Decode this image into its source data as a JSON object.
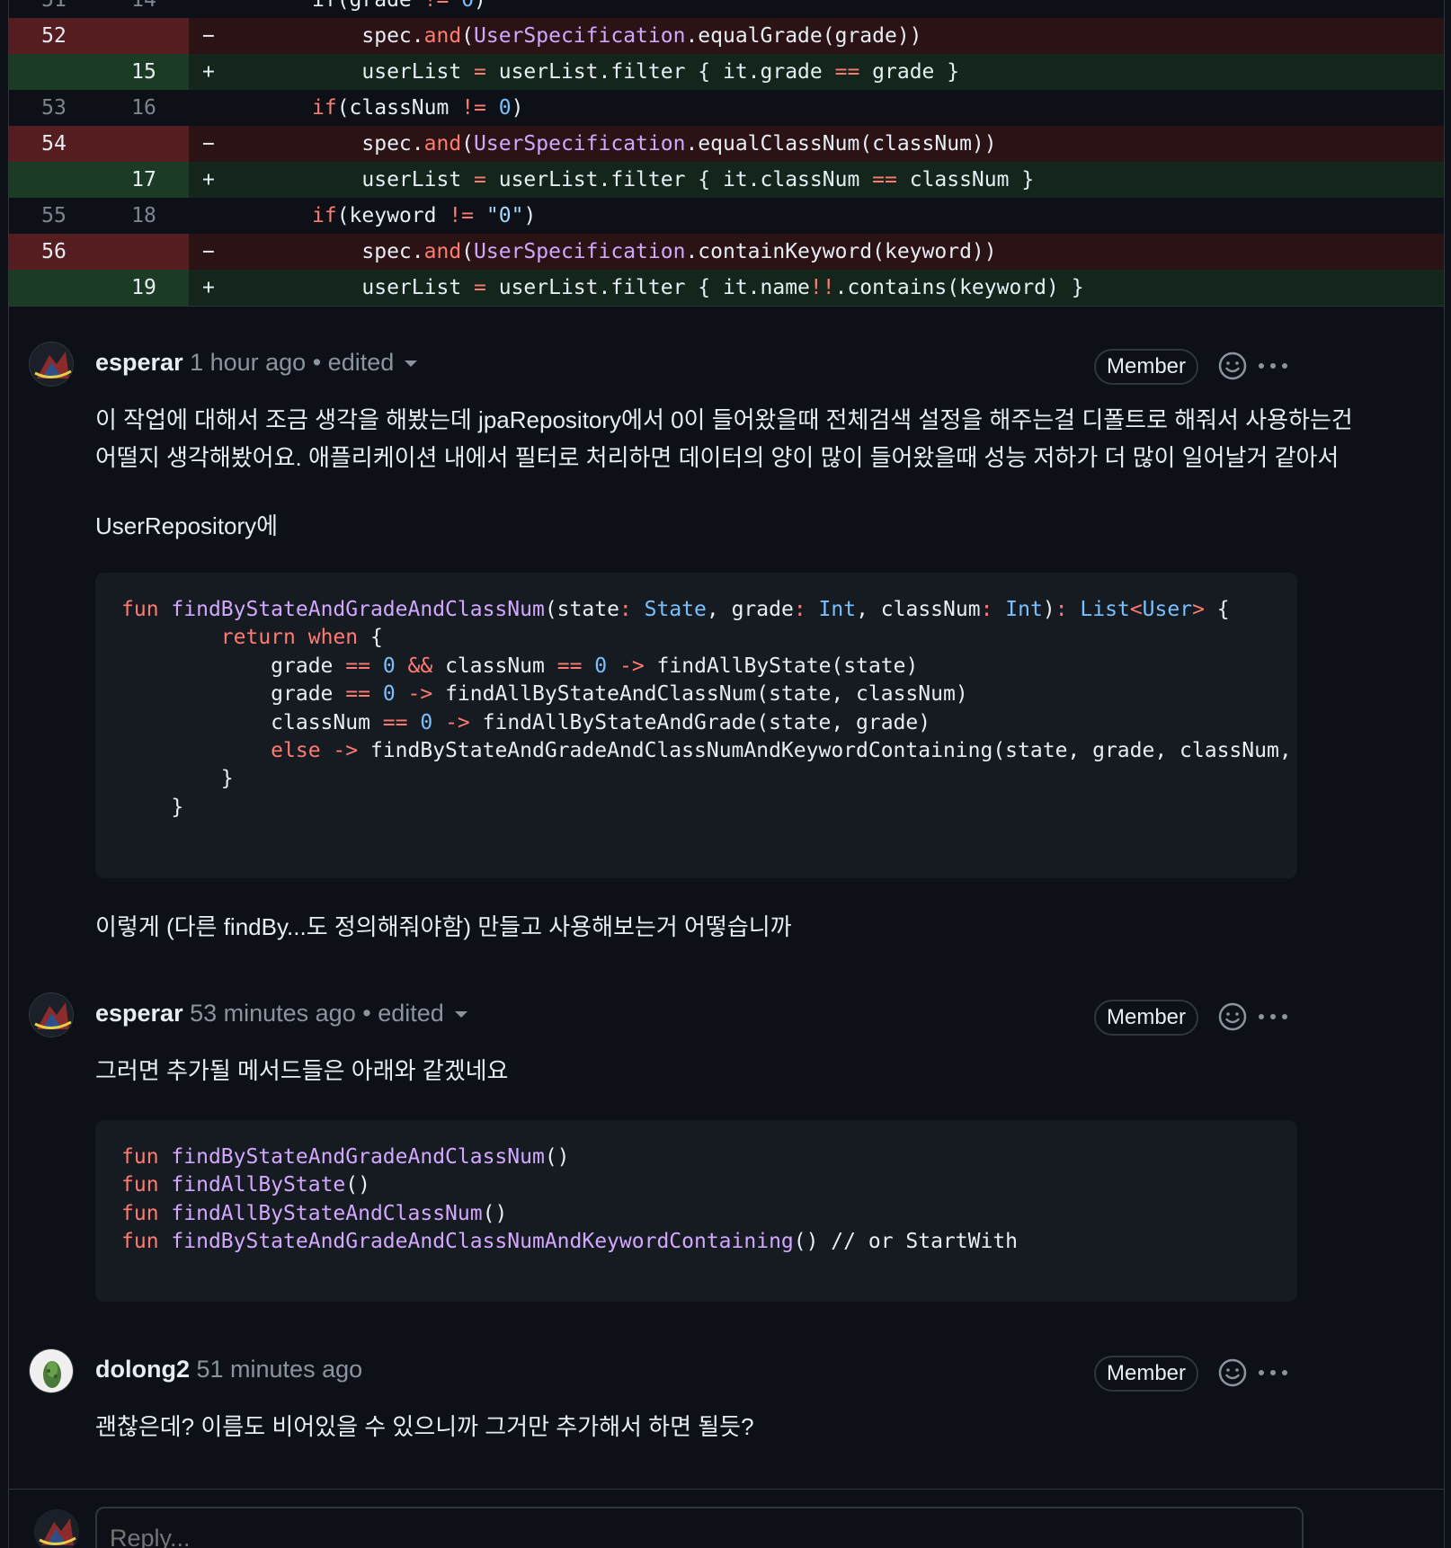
{
  "diff": {
    "rows": [
      {
        "type": "ctx",
        "old": "51",
        "new": "14",
        "sign": "",
        "partial": true
      },
      {
        "type": "del",
        "old": "52",
        "new": "",
        "sign": "−"
      },
      {
        "type": "add",
        "old": "",
        "new": "15",
        "sign": "+"
      },
      {
        "type": "ctx",
        "old": "53",
        "new": "16",
        "sign": ""
      },
      {
        "type": "del",
        "old": "54",
        "new": "",
        "sign": "−"
      },
      {
        "type": "add",
        "old": "",
        "new": "17",
        "sign": "+"
      },
      {
        "type": "ctx",
        "old": "55",
        "new": "18",
        "sign": ""
      },
      {
        "type": "del",
        "old": "56",
        "new": "",
        "sign": "−"
      },
      {
        "type": "add",
        "old": "",
        "new": "19",
        "sign": "+"
      }
    ],
    "code": [
      [
        [
          "if(grade ",
          ""
        ],
        [
          "!=",
          "op"
        ],
        [
          " ",
          ""
        ],
        [
          "0",
          "t"
        ],
        [
          ")",
          ""
        ]
      ],
      [
        [
          "    spec.",
          ""
        ],
        [
          "and",
          "k"
        ],
        [
          "(",
          ""
        ],
        [
          "UserSpecification",
          "f"
        ],
        [
          ".equalGrade(grade))",
          ""
        ]
      ],
      [
        [
          "    userList ",
          ""
        ],
        [
          "=",
          "op"
        ],
        [
          " userList.filter { it.grade ",
          ""
        ],
        [
          "==",
          "op"
        ],
        [
          " grade }",
          ""
        ]
      ],
      [
        [
          "if",
          "k"
        ],
        [
          "(classNum ",
          ""
        ],
        [
          "!=",
          "op"
        ],
        [
          " ",
          ""
        ],
        [
          "0",
          "t"
        ],
        [
          ")",
          ""
        ]
      ],
      [
        [
          "    spec.",
          ""
        ],
        [
          "and",
          "k"
        ],
        [
          "(",
          ""
        ],
        [
          "UserSpecification",
          "f"
        ],
        [
          ".equalClassNum(classNum))",
          ""
        ]
      ],
      [
        [
          "    userList ",
          ""
        ],
        [
          "=",
          "op"
        ],
        [
          " userList.filter { it.classNum ",
          ""
        ],
        [
          "==",
          "op"
        ],
        [
          " classNum }",
          ""
        ]
      ],
      [
        [
          "if",
          "k"
        ],
        [
          "(keyword ",
          ""
        ],
        [
          "!=",
          "op"
        ],
        [
          " ",
          ""
        ],
        [
          "\"0\"",
          "s"
        ],
        [
          ")",
          ""
        ]
      ],
      [
        [
          "    spec.",
          ""
        ],
        [
          "and",
          "k"
        ],
        [
          "(",
          ""
        ],
        [
          "UserSpecification",
          "f"
        ],
        [
          ".containKeyword(keyword))",
          ""
        ]
      ],
      [
        [
          "    userList ",
          ""
        ],
        [
          "=",
          "op"
        ],
        [
          " userList.filter { it.name",
          ""
        ],
        [
          "!!",
          "op"
        ],
        [
          ".contains(keyword) }",
          ""
        ]
      ]
    ]
  },
  "comments": [
    {
      "author": "esperar",
      "time": "1 hour ago",
      "edited": "• edited",
      "badge": "Member",
      "body1": "이 작업에 대해서 조금 생각을 해봤는데 jpaRepository에서 0이 들어왔을때 전체검색 설정을 해주는걸 디폴트로 해줘서 사용하는건\n어떨지 생각해봤어요. 애플리케이션 내에서 필터로 처리하면 데이터의 양이 많이 들어왔을때 성능 저하가 더 많이 일어날거 같아서",
      "body2": "UserRepository에",
      "code": [
        [
          [
            "fun",
            "k"
          ],
          [
            " ",
            ""
          ],
          [
            "findByStateAndGradeAndClassNum",
            "f"
          ],
          [
            "(state",
            ""
          ],
          [
            ":",
            "op"
          ],
          [
            " ",
            ""
          ],
          [
            "State",
            "t"
          ],
          [
            ", grade",
            ""
          ],
          [
            ":",
            "op"
          ],
          [
            " ",
            ""
          ],
          [
            "Int",
            "t"
          ],
          [
            ", classNum",
            ""
          ],
          [
            ":",
            "op"
          ],
          [
            " ",
            ""
          ],
          [
            "Int",
            "t"
          ],
          [
            ")",
            ""
          ],
          [
            ":",
            "op"
          ],
          [
            " ",
            ""
          ],
          [
            "List",
            "t"
          ],
          [
            "<",
            "op"
          ],
          [
            "User",
            "t"
          ],
          [
            ">",
            "op"
          ],
          [
            " {",
            ""
          ]
        ],
        [
          [
            "        ",
            ""
          ],
          [
            "return",
            "k"
          ],
          [
            " ",
            ""
          ],
          [
            "when",
            "k"
          ],
          [
            " {",
            ""
          ]
        ],
        [
          [
            "            grade ",
            ""
          ],
          [
            "==",
            "op"
          ],
          [
            " ",
            ""
          ],
          [
            "0",
            "t"
          ],
          [
            " ",
            ""
          ],
          [
            "&&",
            "op"
          ],
          [
            " classNum ",
            ""
          ],
          [
            "==",
            "op"
          ],
          [
            " ",
            ""
          ],
          [
            "0",
            "t"
          ],
          [
            " ",
            ""
          ],
          [
            "->",
            "op"
          ],
          [
            " findAllByState(state)",
            ""
          ]
        ],
        [
          [
            "            grade ",
            ""
          ],
          [
            "==",
            "op"
          ],
          [
            " ",
            ""
          ],
          [
            "0",
            "t"
          ],
          [
            " ",
            ""
          ],
          [
            "->",
            "op"
          ],
          [
            " findAllByStateAndClassNum(state, classNum)",
            ""
          ]
        ],
        [
          [
            "            classNum ",
            ""
          ],
          [
            "==",
            "op"
          ],
          [
            " ",
            ""
          ],
          [
            "0",
            "t"
          ],
          [
            " ",
            ""
          ],
          [
            "->",
            "op"
          ],
          [
            " findAllByStateAndGrade(state, grade)",
            ""
          ]
        ],
        [
          [
            "            ",
            ""
          ],
          [
            "else",
            "k"
          ],
          [
            " ",
            ""
          ],
          [
            "->",
            "op"
          ],
          [
            " findByStateAndGradeAndClassNumAndKeywordContaining(state, grade, classNum, keywo",
            ""
          ]
        ],
        [
          [
            "        }",
            ""
          ]
        ],
        [
          [
            "    }",
            ""
          ]
        ]
      ],
      "body3": "이렇게 (다른 findBy...도 정의해줘야함) 만들고 사용해보는거 어떻습니까"
    },
    {
      "author": "esperar",
      "time": "53 minutes ago",
      "edited": "• edited",
      "badge": "Member",
      "body1": "그러면 추가될 메서드들은 아래와 같겠네요",
      "code": [
        [
          [
            "fun",
            "k"
          ],
          [
            " ",
            ""
          ],
          [
            "findByStateAndGradeAndClassNum",
            "f"
          ],
          [
            "()",
            ""
          ]
        ],
        [
          [
            "fun",
            "k"
          ],
          [
            " ",
            ""
          ],
          [
            "findAllByState",
            "f"
          ],
          [
            "()",
            ""
          ]
        ],
        [
          [
            "fun",
            "k"
          ],
          [
            " ",
            ""
          ],
          [
            "findAllByStateAndClassNum",
            "f"
          ],
          [
            "()",
            ""
          ]
        ],
        [
          [
            "fun",
            "k"
          ],
          [
            " ",
            ""
          ],
          [
            "findByStateAndGradeAndClassNumAndKeywordContaining",
            "f"
          ],
          [
            "() // or StartWith",
            ""
          ]
        ]
      ]
    },
    {
      "author": "dolong2",
      "time": "51 minutes ago",
      "badge": "Member",
      "body1": "괜찮은데? 이름도 비어있을 수 있으니까 그거만 추가해서 하면 될듯?"
    }
  ],
  "reply": {
    "placeholder": "Reply..."
  }
}
